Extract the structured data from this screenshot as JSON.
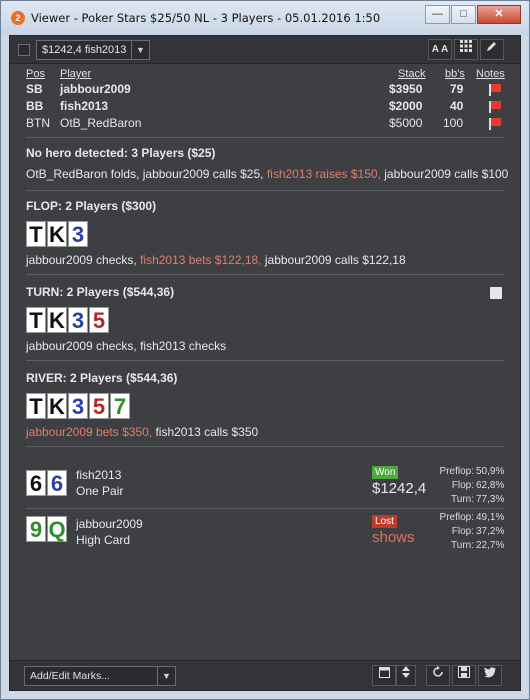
{
  "window": {
    "title": "Viewer - Poker Stars $25/50 NL - 3 Players - 05.01.2016 1:50",
    "app_icon_glyph": "2",
    "controls": {
      "minimize": "—",
      "maximize": "□",
      "close": "✕"
    }
  },
  "toolbar": {
    "hand_select": "$1242,4 fish2013",
    "font_button": "A A",
    "grid_icon": "grid-icon",
    "edit_icon": "pencil-icon"
  },
  "players": {
    "headers": {
      "pos": "Pos",
      "player": "Player",
      "stack": "Stack",
      "bbs": "bb's",
      "notes": "Notes"
    },
    "rows": [
      {
        "pos": "SB",
        "name": "jabbour2009",
        "stack": "$3950",
        "bbs": "79",
        "bold": true
      },
      {
        "pos": "BB",
        "name": "fish2013",
        "stack": "$2000",
        "bbs": "40",
        "bold": true
      },
      {
        "pos": "BTN",
        "name": "OtB_RedBaron",
        "stack": "$5000",
        "bbs": "100",
        "bold": false
      }
    ],
    "note_color": "#e04028"
  },
  "preflop": {
    "title": "No hero detected: 3 Players ($25)",
    "action_1": "OtB_RedBaron folds, jabbour2009 calls $25, ",
    "action_2": "fish2013 raises $150,",
    "action_3": " jabbour2009 calls $100"
  },
  "flop": {
    "title": "FLOP: 2 Players ($300)",
    "cards": [
      {
        "rank": "T",
        "color": "k"
      },
      {
        "rank": "K",
        "color": "k"
      },
      {
        "rank": "3",
        "color": "b"
      }
    ],
    "action_1": "jabbour2009 checks, ",
    "action_2": "fish2013 bets $122,18,",
    "action_3": " jabbour2009 calls $122,18"
  },
  "turn": {
    "title": "TURN: 2 Players ($544,36)",
    "cards": [
      {
        "rank": "T",
        "color": "k"
      },
      {
        "rank": "K",
        "color": "k"
      },
      {
        "rank": "3",
        "color": "b"
      },
      {
        "rank": "5",
        "color": "r"
      }
    ],
    "action_1": "jabbour2009 checks, fish2013 checks"
  },
  "river": {
    "title": "RIVER: 2 Players ($544,36)",
    "cards": [
      {
        "rank": "T",
        "color": "k"
      },
      {
        "rank": "K",
        "color": "k"
      },
      {
        "rank": "3",
        "color": "b"
      },
      {
        "rank": "5",
        "color": "r"
      },
      {
        "rank": "7",
        "color": "g"
      }
    ],
    "action_1": "jabbour2009 bets $350,",
    "action_2": " fish2013 calls $350"
  },
  "results": [
    {
      "name": "fish2013",
      "hand": "One Pair",
      "cards": [
        {
          "rank": "6",
          "color": "k"
        },
        {
          "rank": "6",
          "color": "b"
        }
      ],
      "badge": "Won",
      "amount": "$1242,4",
      "equity": [
        {
          "label": "Preflop:",
          "value": "50,9%"
        },
        {
          "label": "Flop:",
          "value": "62,8%"
        },
        {
          "label": "Turn:",
          "value": "77,3%"
        }
      ]
    },
    {
      "name": "jabbour2009",
      "hand": "High Card",
      "cards": [
        {
          "rank": "9",
          "color": "g"
        },
        {
          "rank": "Q",
          "color": "g"
        }
      ],
      "badge": "Lost",
      "amount": "shows",
      "equity": [
        {
          "label": "Preflop:",
          "value": "49,1%"
        },
        {
          "label": "Flop:",
          "value": "37,2%"
        },
        {
          "label": "Turn:",
          "value": "22,7%"
        }
      ]
    }
  ],
  "footer": {
    "marks_placeholder": "Add/Edit Marks...",
    "icons": [
      "calendar-icon",
      "sort-icon",
      "refresh-icon",
      "save-icon",
      "twitter-icon"
    ]
  },
  "colors": {
    "background": "#3d3f43",
    "highlight": "#e27d6c",
    "won": "#4caa3c",
    "lost": "#c0392b"
  }
}
